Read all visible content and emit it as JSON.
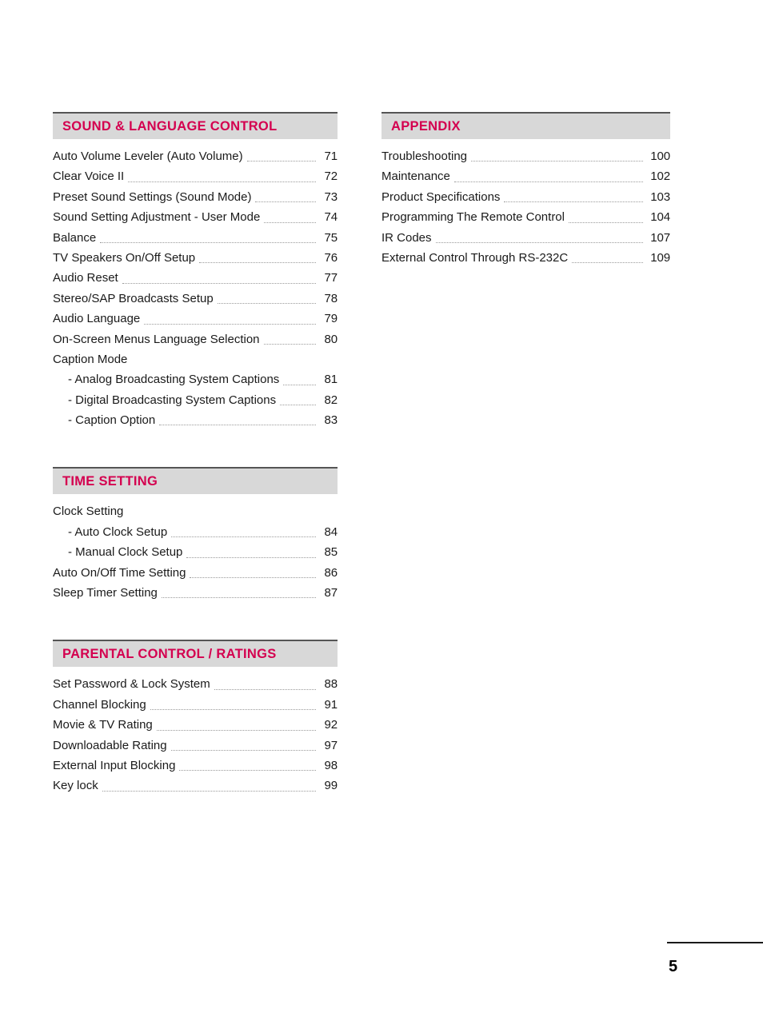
{
  "document": {
    "page_number": "5",
    "accent_color": "#d4004f",
    "header_bar_color": "#d8d8d8",
    "header_rule_color": "#555555"
  },
  "columns": {
    "left": [
      {
        "title": "SOUND & LANGUAGE CONTROL",
        "entries": [
          {
            "label": "Auto Volume Leveler (Auto Volume)",
            "page": "71",
            "indent": false
          },
          {
            "label": "Clear Voice II",
            "page": "72",
            "indent": false
          },
          {
            "label": "Preset Sound Settings (Sound Mode)",
            "page": "73",
            "indent": false
          },
          {
            "label": "Sound Setting Adjustment - User Mode",
            "page": "74",
            "indent": false
          },
          {
            "label": "Balance",
            "page": "75",
            "indent": false
          },
          {
            "label": "TV Speakers On/Off Setup",
            "page": "76",
            "indent": false
          },
          {
            "label": "Audio Reset",
            "page": "77",
            "indent": false
          },
          {
            "label": "Stereo/SAP Broadcasts Setup",
            "page": "78",
            "indent": false
          },
          {
            "label": "Audio Language",
            "page": "79",
            "indent": false
          },
          {
            "label": "On-Screen Menus Language Selection",
            "page": "80",
            "indent": false
          },
          {
            "label": "Caption Mode",
            "page": "",
            "indent": false
          },
          {
            "label": "- Analog Broadcasting System Captions",
            "page": "81",
            "indent": true
          },
          {
            "label": "- Digital Broadcasting System Captions",
            "page": "82",
            "indent": true
          },
          {
            "label": "- Caption Option",
            "page": "83",
            "indent": true
          }
        ]
      },
      {
        "title": "TIME SETTING",
        "entries": [
          {
            "label": "Clock Setting",
            "page": "",
            "indent": false
          },
          {
            "label": "- Auto Clock Setup",
            "page": "84",
            "indent": true
          },
          {
            "label": "- Manual Clock Setup",
            "page": "85",
            "indent": true
          },
          {
            "label": "Auto On/Off Time Setting",
            "page": "86",
            "indent": false
          },
          {
            "label": "Sleep Timer Setting",
            "page": "87",
            "indent": false
          }
        ]
      },
      {
        "title": "PARENTAL CONTROL / RATINGS",
        "entries": [
          {
            "label": "Set Password & Lock System",
            "page": "88",
            "indent": false
          },
          {
            "label": "Channel Blocking",
            "page": "91",
            "indent": false
          },
          {
            "label": "Movie & TV Rating",
            "page": "92",
            "indent": false
          },
          {
            "label": "Downloadable Rating",
            "page": "97",
            "indent": false
          },
          {
            "label": "External Input Blocking",
            "page": "98",
            "indent": false
          },
          {
            "label": "Key lock",
            "page": "99",
            "indent": false
          }
        ]
      }
    ],
    "right": [
      {
        "title": "APPENDIX",
        "entries": [
          {
            "label": "Troubleshooting",
            "page": "100",
            "indent": false
          },
          {
            "label": "Maintenance",
            "page": "102",
            "indent": false
          },
          {
            "label": "Product Specifications",
            "page": "103",
            "indent": false
          },
          {
            "label": "Programming The Remote Control",
            "page": "104",
            "indent": false
          },
          {
            "label": "IR Codes",
            "page": "107",
            "indent": false
          },
          {
            "label": "External Control Through RS-232C",
            "page": "109",
            "indent": false
          }
        ]
      }
    ]
  }
}
